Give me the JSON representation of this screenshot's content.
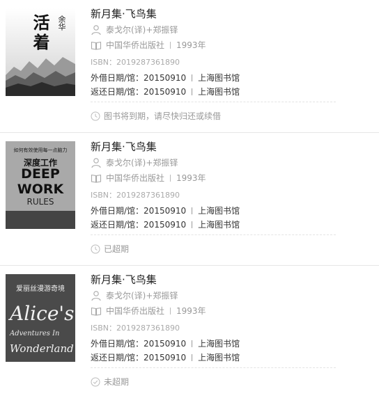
{
  "books": [
    {
      "title": "新月集·飞鸟集",
      "author": "泰戈尔(译)+郑振铎",
      "publisher": "中国华侨出版社",
      "year": "1993年",
      "isbn": "ISBN：2019287361890",
      "borrow": {
        "label": "外借日期/馆：",
        "date": "20150910",
        "library": "上海图书馆"
      },
      "return": {
        "label": "返还日期/馆：",
        "date": "20150910",
        "library": "上海图书馆"
      },
      "status": {
        "text": "图书将到期，请尽快归还或续借",
        "icon": "clock-icon"
      },
      "cover": {
        "title": "活着",
        "author": "余华"
      }
    },
    {
      "title": "新月集·飞鸟集",
      "author": "泰戈尔(译)+郑振铎",
      "publisher": "中国华侨出版社",
      "year": "1993年",
      "isbn": "ISBN：2019287361890",
      "borrow": {
        "label": "外借日期/馆：",
        "date": "20150910",
        "library": "上海图书馆"
      },
      "return": {
        "label": "返还日期/馆：",
        "date": "20150910",
        "library": "上海图书馆"
      },
      "status": {
        "text": "已超期",
        "icon": "clock-icon"
      },
      "cover": {
        "top": "如何有效使用每一点脑力",
        "title_cn": "深度工作",
        "line1": "DEEP",
        "line2": "WORK",
        "line3": "RULES"
      }
    },
    {
      "title": "新月集·飞鸟集",
      "author": "泰戈尔(译)+郑振铎",
      "publisher": "中国华侨出版社",
      "year": "1993年",
      "isbn": "ISBN：2019287361890",
      "borrow": {
        "label": "外借日期/馆：",
        "date": "20150910",
        "library": "上海图书馆"
      },
      "return": {
        "label": "返还日期/馆：",
        "date": "20150910",
        "library": "上海图书馆"
      },
      "status": {
        "text": "未超期",
        "icon": "check-circle-icon"
      },
      "cover": {
        "top": "爱丽丝漫游奇境",
        "line1": "Alice's",
        "line2": "Adventures In",
        "line3": "Wonderland"
      }
    }
  ]
}
